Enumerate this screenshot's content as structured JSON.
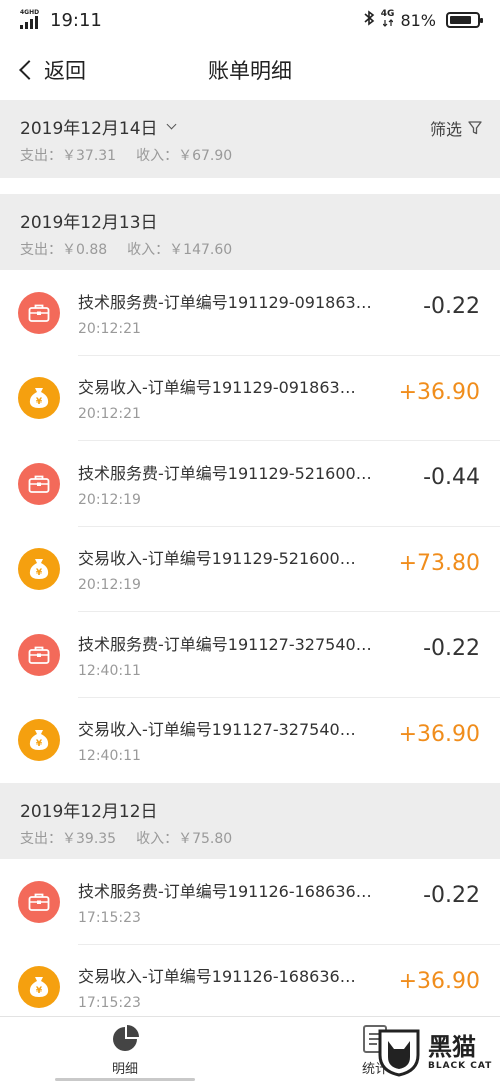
{
  "status_bar": {
    "network_tag": "4GHD",
    "time": "19:11",
    "net_type": "4G",
    "battery": "81%",
    "battery_level": 0.81
  },
  "nav": {
    "back_label": "返回",
    "title": "账单明细"
  },
  "filter_label": "筛选",
  "days": [
    {
      "date": "2019年12月14日",
      "expense": "支出：￥37.31",
      "income": "收入：￥67.90",
      "transactions": []
    },
    {
      "date": "2019年12月13日",
      "expense": "支出：￥0.88",
      "income": "收入：￥147.60",
      "transactions": [
        {
          "kind": "fee",
          "title": "技术服务费-订单编号191129-091863…",
          "time": "20:12:21",
          "amount": "-0.22"
        },
        {
          "kind": "income",
          "title": "交易收入-订单编号191129-091863…",
          "time": "20:12:21",
          "amount": "+36.90"
        },
        {
          "kind": "fee",
          "title": "技术服务费-订单编号191129-521600…",
          "time": "20:12:19",
          "amount": "-0.44"
        },
        {
          "kind": "income",
          "title": "交易收入-订单编号191129-521600…",
          "time": "20:12:19",
          "amount": "+73.80"
        },
        {
          "kind": "fee",
          "title": "技术服务费-订单编号191127-327540…",
          "time": "12:40:11",
          "amount": "-0.22"
        },
        {
          "kind": "income",
          "title": "交易收入-订单编号191127-327540…",
          "time": "12:40:11",
          "amount": "+36.90"
        }
      ]
    },
    {
      "date": "2019年12月12日",
      "expense": "支出：￥39.35",
      "income": "收入：￥75.80",
      "transactions": [
        {
          "kind": "fee",
          "title": "技术服务费-订单编号191126-168636…",
          "time": "17:15:23",
          "amount": "-0.22"
        },
        {
          "kind": "income",
          "title": "交易收入-订单编号191126-168636…",
          "time": "17:15:23",
          "amount": "+36.90"
        }
      ]
    }
  ],
  "tabs": [
    {
      "label": "明细",
      "icon": "pie-chart-icon"
    },
    {
      "label": "统计",
      "icon": "report-icon"
    }
  ],
  "watermark": {
    "main": "黑猫",
    "sub": "BLACK CAT"
  },
  "colors": {
    "fee_icon": "#f36a5a",
    "income_icon": "#f5a00f",
    "positive_amount": "#f08d1c",
    "header_bg": "#ededed"
  }
}
